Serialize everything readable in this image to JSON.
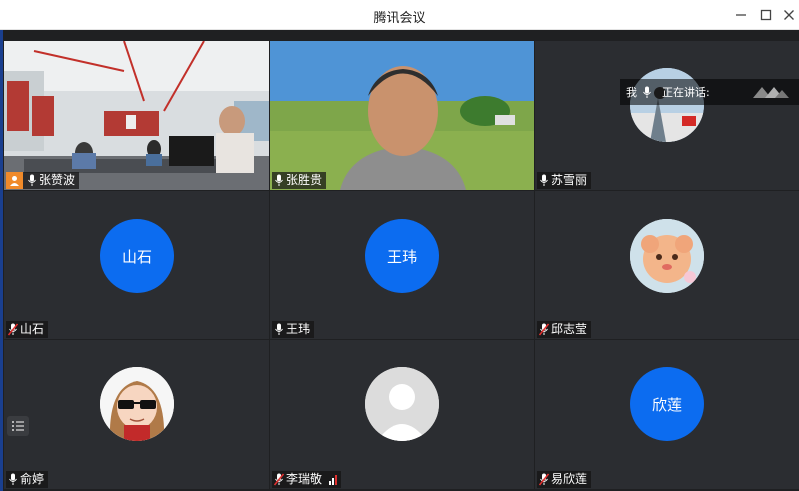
{
  "window": {
    "title": "腾讯会议"
  },
  "speaking_bar": {
    "self_label": "我",
    "speaking_label": "正在讲话:"
  },
  "participants": [
    {
      "name": "张赞波",
      "type": "video",
      "host": true
    },
    {
      "name": "张胜贵",
      "type": "video"
    },
    {
      "name": "苏雪丽",
      "type": "avatar-image"
    },
    {
      "name": "山石",
      "type": "avatar-text",
      "avatar_text": "山石",
      "muted": true
    },
    {
      "name": "王玮",
      "type": "avatar-text",
      "avatar_text": "王玮"
    },
    {
      "name": "邱志莹",
      "type": "avatar-image",
      "muted": true
    },
    {
      "name": "俞婷",
      "type": "avatar-image"
    },
    {
      "name": "李瑞敬",
      "type": "avatar-default",
      "muted": true,
      "signal": true
    },
    {
      "name": "易欣莲",
      "type": "avatar-text",
      "avatar_text": "欣莲",
      "muted": true
    }
  ],
  "colors": {
    "avatar_blue": "#0c6cf0",
    "tile_bg": "#2b2d31",
    "host_badge": "#f08a2a",
    "mute_red": "#e0302f"
  }
}
